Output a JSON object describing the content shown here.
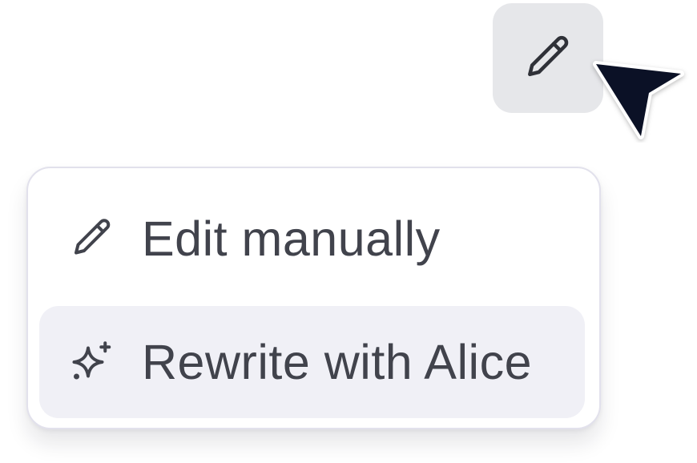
{
  "toolbar": {
    "edit_icon": "pencil-icon",
    "cursor_icon": "mouse-pointer-icon"
  },
  "menu": {
    "items": [
      {
        "label": "Edit manually",
        "icon": "pencil-icon"
      },
      {
        "label": "Rewrite with Alice",
        "icon": "sparkles-icon",
        "highlighted": true
      }
    ]
  },
  "colors": {
    "button_bg": "#e6e7ea",
    "highlight_bg": "#f0f0f6",
    "text": "#41434c",
    "cursor": "#0b1126",
    "menu_border": "#e2e1ec"
  }
}
